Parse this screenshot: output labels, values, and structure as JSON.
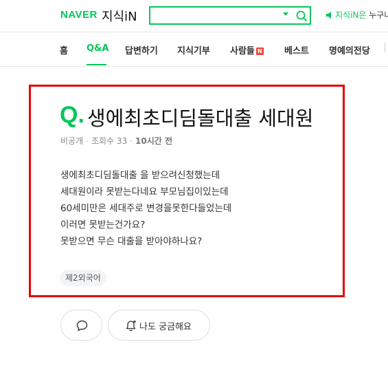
{
  "header": {
    "brand": "NAVER",
    "service": "지식iN",
    "search": {
      "value": "",
      "placeholder": ""
    },
    "notice_prefix": "지식iN은",
    "notice_rest": "누구나"
  },
  "nav": {
    "items": [
      {
        "label": "홈"
      },
      {
        "label": "Q&A",
        "active": true
      },
      {
        "label": "답변하기"
      },
      {
        "label": "지식기부"
      },
      {
        "label": "사람들",
        "badge": "N"
      },
      {
        "label": "베스트"
      },
      {
        "label": "명예의전당"
      }
    ]
  },
  "question": {
    "q_mark": "Q.",
    "title": "생에최초디딤돌대출 세대원",
    "author": "비공개",
    "views_label": "조회수",
    "views": "33",
    "time": "10시간 전",
    "body_lines": [
      "생에최초디딤돌대출 을 받으려신청했는데",
      "세대원이라 못받는다네요 부모님집이있는데",
      "60세미만은 세대주로 변경을못한다들었는데",
      "이러면 못받는건가요?",
      "못받으면 무슨 대출을 받아야하나요?"
    ],
    "tag": "제2외국어"
  },
  "actions": {
    "curious_label": "나도 궁금해요"
  },
  "colors": {
    "brand_green": "#03c75a",
    "highlight_red": "#e00000",
    "badge_red": "#e84c3d"
  },
  "icons": [
    "search-icon",
    "chevron-down-icon",
    "speaker-icon",
    "comment-icon",
    "bell-plus-icon"
  ]
}
